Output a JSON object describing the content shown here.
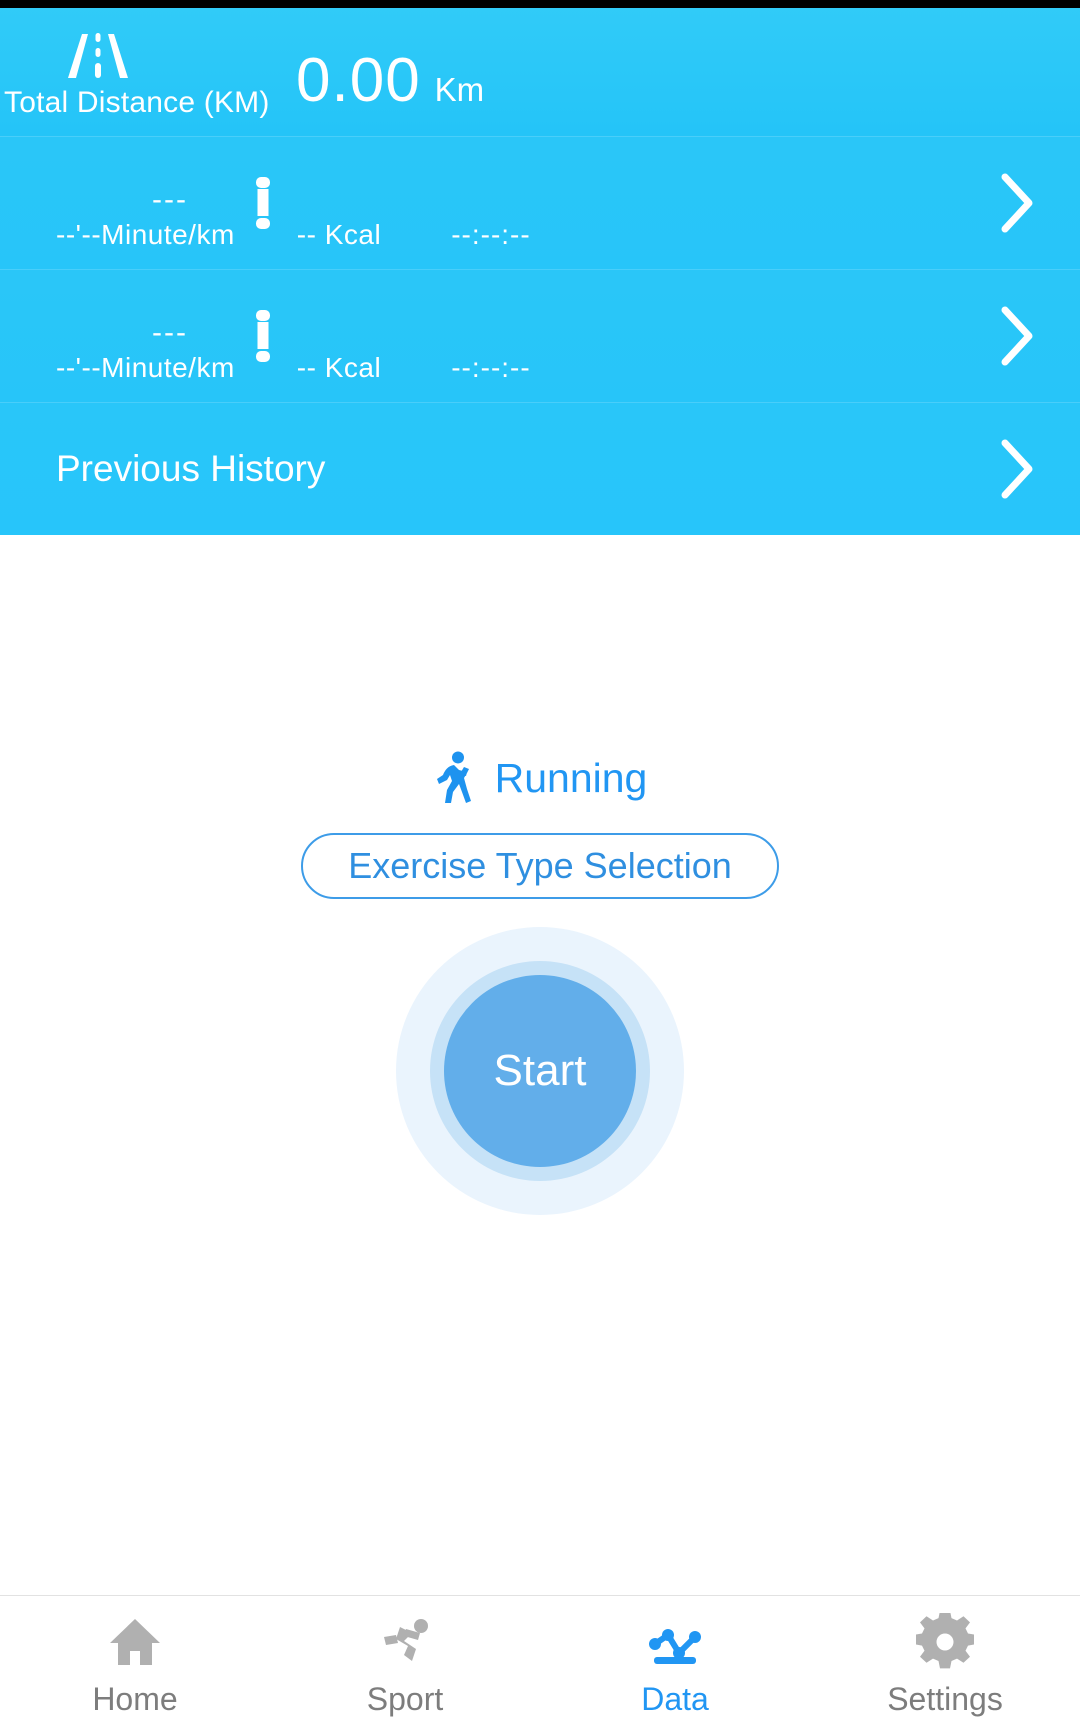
{
  "header": {
    "road_icon": "road-icon",
    "total_distance_label": "Total Distance (KM)",
    "total_distance_value": "0.00",
    "total_distance_unit": "Km"
  },
  "records": [
    {
      "distance": "---",
      "device_icon": "band-icon",
      "pace": "--'--Minute/km",
      "calories": "-- Kcal",
      "duration": "--:--:--",
      "chevron": "chevron-right-icon"
    },
    {
      "distance": "---",
      "device_icon": "band-icon",
      "pace": "--'--Minute/km",
      "calories": "-- Kcal",
      "duration": "--:--:--",
      "chevron": "chevron-right-icon"
    }
  ],
  "history": {
    "label": "Previous History",
    "chevron": "chevron-right-icon"
  },
  "main": {
    "exercise_icon": "running-person-icon",
    "exercise_name": "Running",
    "type_select_label": "Exercise Type Selection",
    "start_label": "Start"
  },
  "bottom_nav": {
    "items": [
      {
        "label": "Home",
        "icon": "home-icon",
        "active": false
      },
      {
        "label": "Sport",
        "icon": "sport-icon",
        "active": false
      },
      {
        "label": "Data",
        "icon": "chart-icon",
        "active": true
      },
      {
        "label": "Settings",
        "icon": "gear-icon",
        "active": false
      }
    ]
  },
  "colors": {
    "header_blue": "#29c6f9",
    "accent_blue": "#2196f3",
    "start_button": "#62aeea",
    "nav_inactive": "#b0b0b0",
    "nav_active": "#2196f3"
  }
}
